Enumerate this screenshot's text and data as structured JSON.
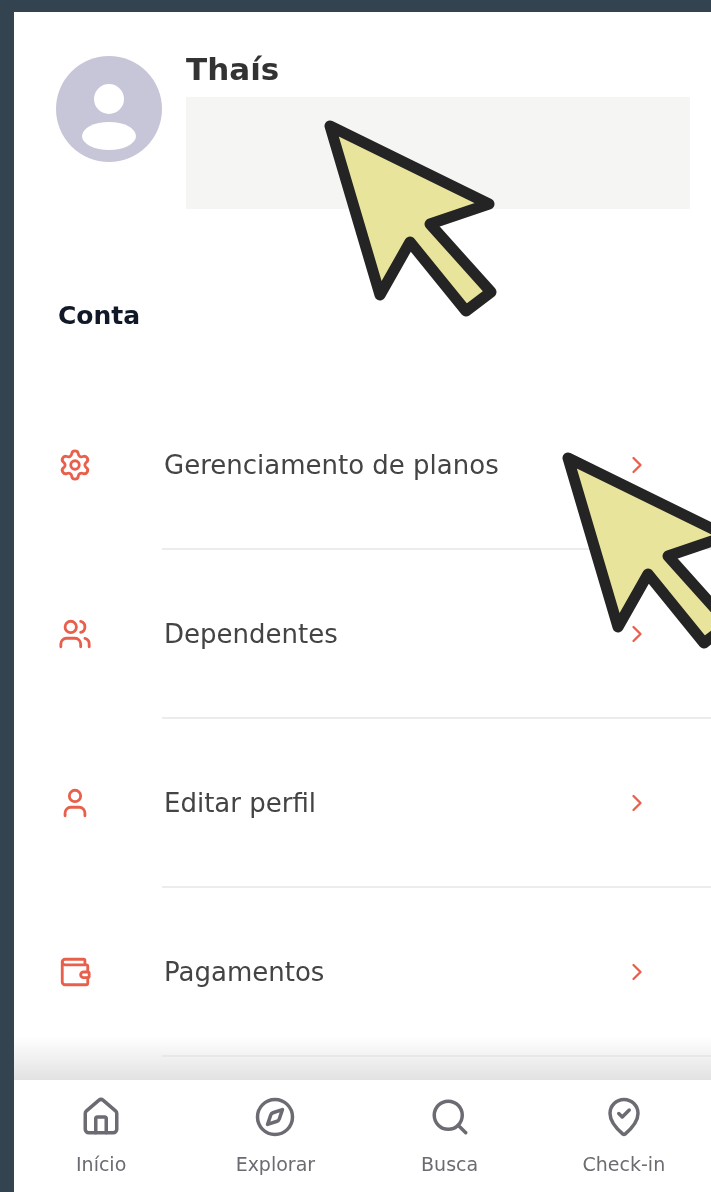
{
  "profile": {
    "name": "Thaís"
  },
  "section_title": "Conta",
  "menu_items": [
    {
      "kind": "settings",
      "label": "Gerenciamento de planos"
    },
    {
      "kind": "dependents",
      "label": "Dependentes"
    },
    {
      "kind": "profile",
      "label": "Editar perfil"
    },
    {
      "kind": "payments",
      "label": "Pagamentos"
    }
  ],
  "bottom_nav": [
    {
      "kind": "home",
      "label": "Início",
      "selected": false
    },
    {
      "kind": "explore",
      "label": "Explorar",
      "selected": false
    },
    {
      "kind": "search",
      "label": "Busca",
      "selected": false
    },
    {
      "kind": "checkin",
      "label": "Check-in",
      "selected": false
    }
  ]
}
